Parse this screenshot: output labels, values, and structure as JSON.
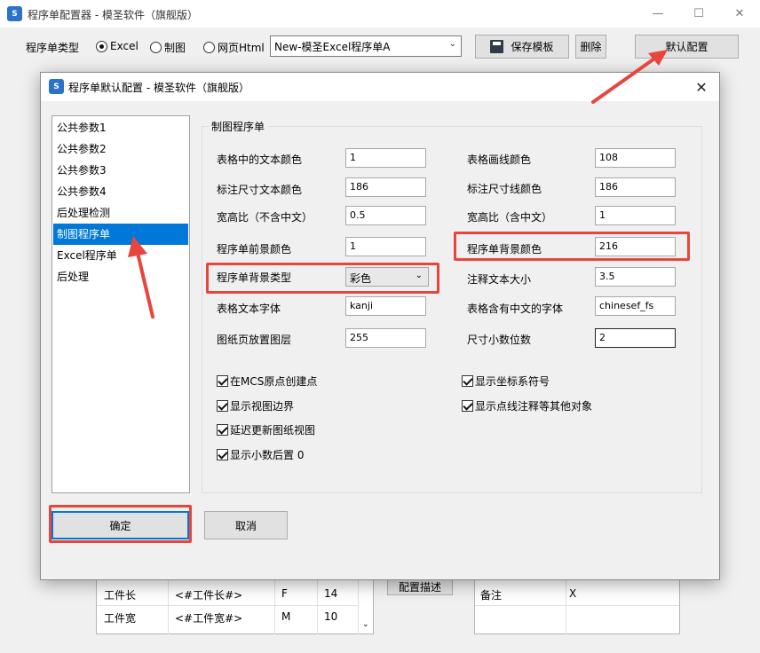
{
  "main_window": {
    "title": "程序单配置器 - 模圣软件（旗舰版）",
    "logo_text": "S",
    "controls": {
      "minimize": "—",
      "maximize": "☐",
      "close": "✕"
    },
    "toolbar": {
      "type_label": "程序单类型",
      "radio_options": [
        {
          "label": "Excel",
          "selected": true
        },
        {
          "label": "制图",
          "selected": false
        },
        {
          "label": "网页Html",
          "selected": false
        }
      ],
      "template_value": "New-模圣Excel程序单A",
      "save_template_label": "保存模板",
      "delete_label": "删除",
      "default_config_label": "默认配置"
    },
    "background": {
      "rows": [
        {
          "name": "工件长",
          "var": "<#工件长#>",
          "code": "F",
          "value": "14"
        },
        {
          "name": "工件宽",
          "var": "<#工件宽#>",
          "code": "M",
          "value": "10"
        }
      ],
      "config_desc_label": "配置描述",
      "note_label": "备注",
      "note_value": "X"
    }
  },
  "dialog": {
    "title": "程序单默认配置 - 模圣软件（旗舰版）",
    "logo_text": "S",
    "close": "✕",
    "nav_items": [
      {
        "label": "公共参数1",
        "selected": false
      },
      {
        "label": "公共参数2",
        "selected": false
      },
      {
        "label": "公共参数3",
        "selected": false
      },
      {
        "label": "公共参数4",
        "selected": false
      },
      {
        "label": "后处理检测",
        "selected": false
      },
      {
        "label": "制图程序单",
        "selected": true
      },
      {
        "label": "Excel程序单",
        "selected": false
      },
      {
        "label": "后处理",
        "selected": false
      }
    ],
    "group_title": "制图程序单",
    "fields_left": [
      {
        "label": "表格中的文本颜色",
        "value": "1"
      },
      {
        "label": "标注尺寸文本颜色",
        "value": "186"
      },
      {
        "label": "宽高比（不含中文）",
        "value": "0.5"
      },
      {
        "label": "程序单前景颜色",
        "value": "1"
      },
      {
        "label": "程序单背景类型",
        "value": "彩色"
      },
      {
        "label": "表格文本字体",
        "value": "kanji"
      },
      {
        "label": "图纸页放置图层",
        "value": "255"
      }
    ],
    "fields_right": [
      {
        "label": "表格画线颜色",
        "value": "108"
      },
      {
        "label": "标注尺寸线颜色",
        "value": "186"
      },
      {
        "label": "宽高比（含中文）",
        "value": "1"
      },
      {
        "label": "程序单背景颜色",
        "value": "216"
      },
      {
        "label": "注释文本大小",
        "value": "3.5"
      },
      {
        "label": "表格含有中文的字体",
        "value": "chinesef_fs"
      },
      {
        "label": "尺寸小数位数",
        "value": "2"
      }
    ],
    "checks_left": [
      {
        "label": "在MCS原点创建点",
        "checked": true
      },
      {
        "label": "显示视图边界",
        "checked": true
      },
      {
        "label": "延迟更新图纸视图",
        "checked": true
      },
      {
        "label": "显示小数后置 0",
        "checked": true
      }
    ],
    "checks_right": [
      {
        "label": "显示坐标系符号",
        "checked": true
      },
      {
        "label": "显示点线注释等其他对象",
        "checked": true
      }
    ],
    "ok_label": "确定",
    "cancel_label": "取消"
  },
  "annotation_color": "#e8453c",
  "selection_color": "#0078d7"
}
